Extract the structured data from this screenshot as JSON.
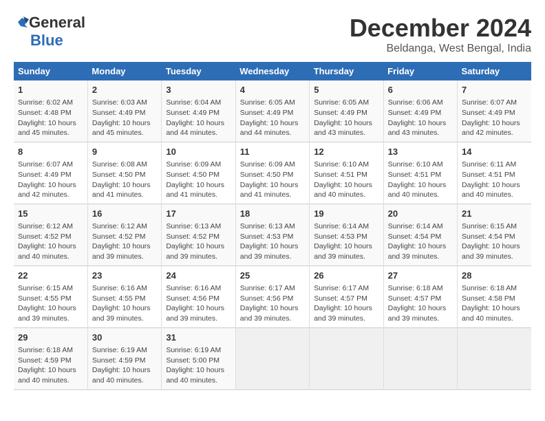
{
  "header": {
    "logo_line1": "General",
    "logo_line2": "Blue",
    "month_title": "December 2024",
    "location": "Beldanga, West Bengal, India"
  },
  "days_of_week": [
    "Sunday",
    "Monday",
    "Tuesday",
    "Wednesday",
    "Thursday",
    "Friday",
    "Saturday"
  ],
  "weeks": [
    [
      {
        "day": "1",
        "info": "Sunrise: 6:02 AM\nSunset: 4:48 PM\nDaylight: 10 hours\nand 45 minutes."
      },
      {
        "day": "2",
        "info": "Sunrise: 6:03 AM\nSunset: 4:49 PM\nDaylight: 10 hours\nand 45 minutes."
      },
      {
        "day": "3",
        "info": "Sunrise: 6:04 AM\nSunset: 4:49 PM\nDaylight: 10 hours\nand 44 minutes."
      },
      {
        "day": "4",
        "info": "Sunrise: 6:05 AM\nSunset: 4:49 PM\nDaylight: 10 hours\nand 44 minutes."
      },
      {
        "day": "5",
        "info": "Sunrise: 6:05 AM\nSunset: 4:49 PM\nDaylight: 10 hours\nand 43 minutes."
      },
      {
        "day": "6",
        "info": "Sunrise: 6:06 AM\nSunset: 4:49 PM\nDaylight: 10 hours\nand 43 minutes."
      },
      {
        "day": "7",
        "info": "Sunrise: 6:07 AM\nSunset: 4:49 PM\nDaylight: 10 hours\nand 42 minutes."
      }
    ],
    [
      {
        "day": "8",
        "info": "Sunrise: 6:07 AM\nSunset: 4:49 PM\nDaylight: 10 hours\nand 42 minutes."
      },
      {
        "day": "9",
        "info": "Sunrise: 6:08 AM\nSunset: 4:50 PM\nDaylight: 10 hours\nand 41 minutes."
      },
      {
        "day": "10",
        "info": "Sunrise: 6:09 AM\nSunset: 4:50 PM\nDaylight: 10 hours\nand 41 minutes."
      },
      {
        "day": "11",
        "info": "Sunrise: 6:09 AM\nSunset: 4:50 PM\nDaylight: 10 hours\nand 41 minutes."
      },
      {
        "day": "12",
        "info": "Sunrise: 6:10 AM\nSunset: 4:51 PM\nDaylight: 10 hours\nand 40 minutes."
      },
      {
        "day": "13",
        "info": "Sunrise: 6:10 AM\nSunset: 4:51 PM\nDaylight: 10 hours\nand 40 minutes."
      },
      {
        "day": "14",
        "info": "Sunrise: 6:11 AM\nSunset: 4:51 PM\nDaylight: 10 hours\nand 40 minutes."
      }
    ],
    [
      {
        "day": "15",
        "info": "Sunrise: 6:12 AM\nSunset: 4:52 PM\nDaylight: 10 hours\nand 40 minutes."
      },
      {
        "day": "16",
        "info": "Sunrise: 6:12 AM\nSunset: 4:52 PM\nDaylight: 10 hours\nand 39 minutes."
      },
      {
        "day": "17",
        "info": "Sunrise: 6:13 AM\nSunset: 4:52 PM\nDaylight: 10 hours\nand 39 minutes."
      },
      {
        "day": "18",
        "info": "Sunrise: 6:13 AM\nSunset: 4:53 PM\nDaylight: 10 hours\nand 39 minutes."
      },
      {
        "day": "19",
        "info": "Sunrise: 6:14 AM\nSunset: 4:53 PM\nDaylight: 10 hours\nand 39 minutes."
      },
      {
        "day": "20",
        "info": "Sunrise: 6:14 AM\nSunset: 4:54 PM\nDaylight: 10 hours\nand 39 minutes."
      },
      {
        "day": "21",
        "info": "Sunrise: 6:15 AM\nSunset: 4:54 PM\nDaylight: 10 hours\nand 39 minutes."
      }
    ],
    [
      {
        "day": "22",
        "info": "Sunrise: 6:15 AM\nSunset: 4:55 PM\nDaylight: 10 hours\nand 39 minutes."
      },
      {
        "day": "23",
        "info": "Sunrise: 6:16 AM\nSunset: 4:55 PM\nDaylight: 10 hours\nand 39 minutes."
      },
      {
        "day": "24",
        "info": "Sunrise: 6:16 AM\nSunset: 4:56 PM\nDaylight: 10 hours\nand 39 minutes."
      },
      {
        "day": "25",
        "info": "Sunrise: 6:17 AM\nSunset: 4:56 PM\nDaylight: 10 hours\nand 39 minutes."
      },
      {
        "day": "26",
        "info": "Sunrise: 6:17 AM\nSunset: 4:57 PM\nDaylight: 10 hours\nand 39 minutes."
      },
      {
        "day": "27",
        "info": "Sunrise: 6:18 AM\nSunset: 4:57 PM\nDaylight: 10 hours\nand 39 minutes."
      },
      {
        "day": "28",
        "info": "Sunrise: 6:18 AM\nSunset: 4:58 PM\nDaylight: 10 hours\nand 40 minutes."
      }
    ],
    [
      {
        "day": "29",
        "info": "Sunrise: 6:18 AM\nSunset: 4:59 PM\nDaylight: 10 hours\nand 40 minutes."
      },
      {
        "day": "30",
        "info": "Sunrise: 6:19 AM\nSunset: 4:59 PM\nDaylight: 10 hours\nand 40 minutes."
      },
      {
        "day": "31",
        "info": "Sunrise: 6:19 AM\nSunset: 5:00 PM\nDaylight: 10 hours\nand 40 minutes."
      },
      null,
      null,
      null,
      null
    ]
  ]
}
